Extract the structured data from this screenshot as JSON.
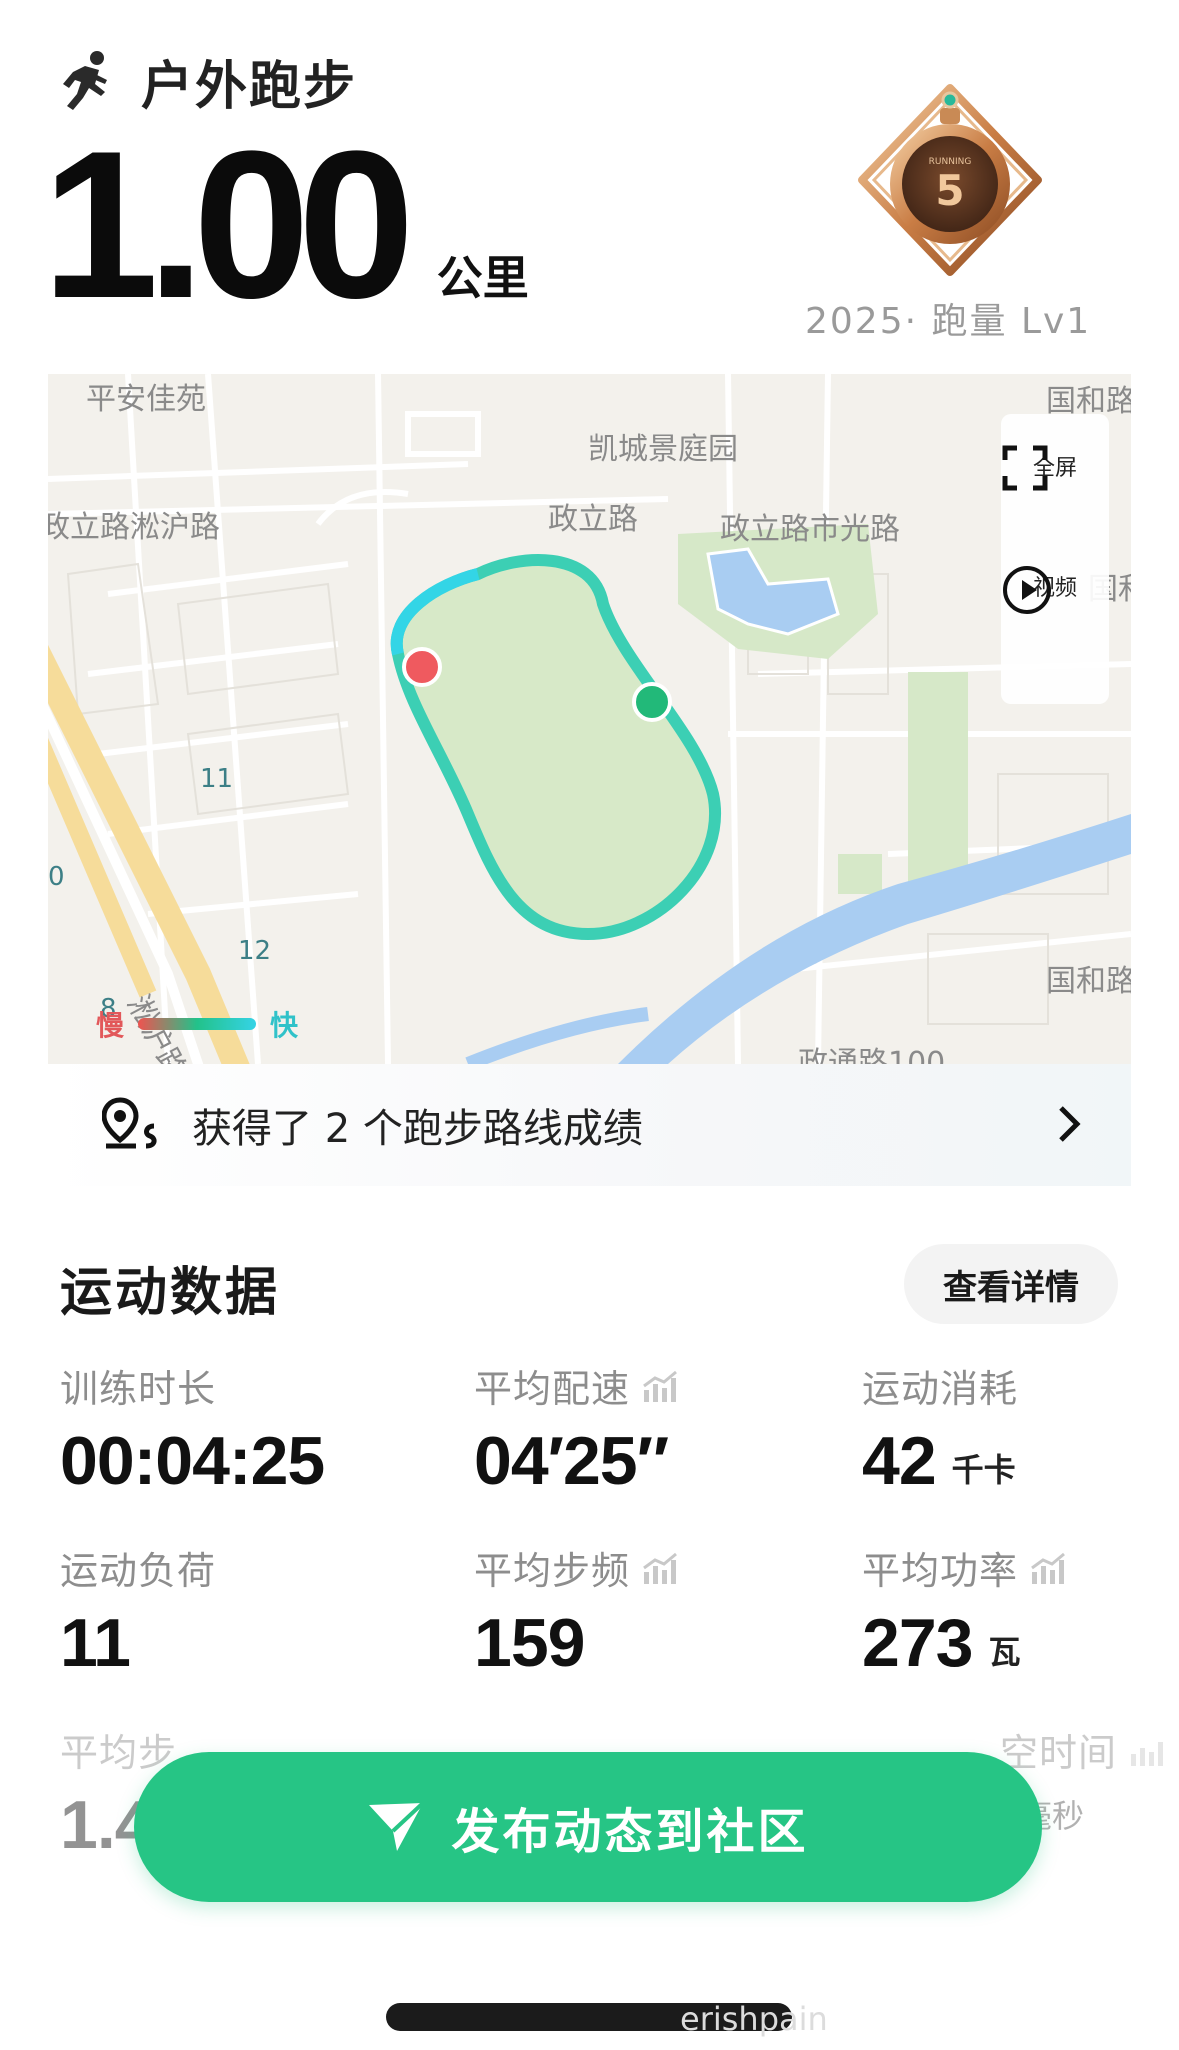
{
  "header": {
    "title": "户外跑步"
  },
  "distance": {
    "value": "1.00",
    "unit": "公里"
  },
  "medal": {
    "caption": "2025· 跑量 Lv1",
    "badge_number": "5",
    "badge_top_text": "RUNNING"
  },
  "map": {
    "labels": [
      "平安佳苑",
      "凯城景庭园",
      "国和路",
      "政立路",
      "政立路市光路",
      "政立路淞沪路",
      "国和路",
      "国和路",
      "政通路100",
      "淞沪路"
    ],
    "road_numbers": [
      "11",
      "12",
      "0",
      "8"
    ],
    "controls": {
      "fullscreen": "全屏",
      "video": "视频"
    },
    "legend": {
      "slow": "慢",
      "fast": "快"
    }
  },
  "route_achievements": {
    "text": "获得了 2 个跑步路线成绩"
  },
  "stats_section": {
    "title": "运动数据",
    "details_button": "查看详情",
    "items": [
      {
        "label": "训练时长",
        "value": "00:04:25",
        "unit": ""
      },
      {
        "label": "平均配速",
        "value": "04′25″",
        "unit": ""
      },
      {
        "label": "运动消耗",
        "value": "42",
        "unit": "千卡"
      },
      {
        "label": "运动负荷",
        "value": "11",
        "unit": ""
      },
      {
        "label": "平均步频",
        "value": "159",
        "unit": ""
      },
      {
        "label": "平均功率",
        "value": "273",
        "unit": "瓦"
      },
      {
        "label": "平均步",
        "value": "1.4",
        "unit": ""
      },
      {
        "label": "空时间",
        "value": "",
        "unit": "毫秒"
      }
    ]
  },
  "publish_button": {
    "label": "发布动态到社区"
  },
  "watermark": "erishpain",
  "colors": {
    "accent": "#26c585",
    "route": "#3ccfb4",
    "start_dot": "#ef5a5f",
    "end_dot": "#22b979"
  }
}
